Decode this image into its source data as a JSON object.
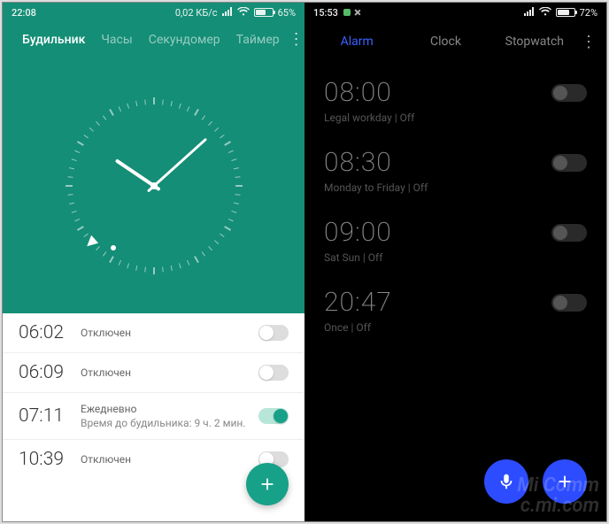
{
  "left": {
    "status": {
      "time": "22:08",
      "dataRate": "0,02 КБ/с",
      "battery": "65%",
      "batteryFill": 65
    },
    "tabs": [
      "Будильник",
      "Часы",
      "Секундомер",
      "Таймер"
    ],
    "activeTab": 0,
    "clock": {
      "hour": 10,
      "minute": 8,
      "second": 38
    },
    "alarms": [
      {
        "time": "06:02",
        "line1": "Отключен",
        "line2": "",
        "on": false
      },
      {
        "time": "06:09",
        "line1": "Отключен",
        "line2": "",
        "on": false
      },
      {
        "time": "07:11",
        "line1": "Ежедневно",
        "line2": "Время до будильника: 9 ч. 2 мин.",
        "on": true
      },
      {
        "time": "10:39",
        "line1": "Отключен",
        "line2": "",
        "on": false
      }
    ]
  },
  "right": {
    "status": {
      "time": "15:53",
      "battery": "72%",
      "batteryFill": 72
    },
    "tabs": [
      "Alarm",
      "Clock",
      "Stopwatch"
    ],
    "activeTab": 0,
    "alarms": [
      {
        "time": "08:00",
        "meta": "Legal workday  |  Off"
      },
      {
        "time": "08:30",
        "meta": "Monday to Friday  |  Off"
      },
      {
        "time": "09:00",
        "meta": "Sat Sun  |  Off"
      },
      {
        "time": "20:47",
        "meta": "Once  |  Off"
      }
    ],
    "watermark1": "Mi Comm",
    "watermark2": "c.mi.com"
  }
}
